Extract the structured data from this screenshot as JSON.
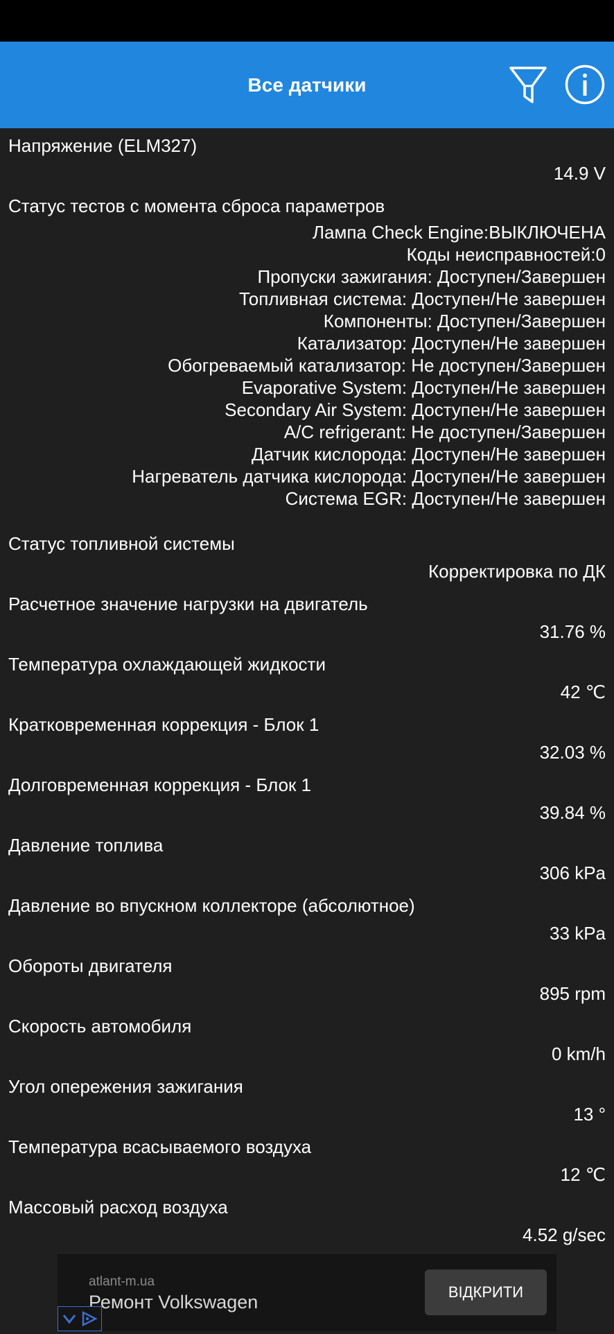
{
  "header": {
    "title": "Все датчики",
    "filter_icon": "filter-icon",
    "info_icon": "info-icon",
    "accent_color": "#2186de"
  },
  "sensors": [
    {
      "name": "Напряжение (ELM327)",
      "value": "14.9 V"
    },
    {
      "name": "Статус тестов с момента сброса параметров",
      "lines": [
        "Лампа Check Engine:ВЫКЛЮЧЕНА",
        "Коды неисправностей:0",
        "Пропуски зажигания: Доступен/Завершен",
        "Топливная система: Доступен/Не завершен",
        "Компоненты: Доступен/Завершен",
        "Катализатор: Доступен/Не завершен",
        "Обогреваемый катализатор: Не доступен/Завершен",
        "Evaporative System: Доступен/Не завершен",
        "Secondary Air System: Доступен/Не завершен",
        "A/C refrigerant: Не доступен/Завершен",
        "Датчик кислорода: Доступен/Не завершен",
        "Нагреватель датчика кислорода: Доступен/Не завершен",
        "Система EGR: Доступен/Не завершен"
      ]
    },
    {
      "name": "Статус топливной системы",
      "value": "Корректировка по ДК"
    },
    {
      "name": "Расчетное значение нагрузки на двигатель",
      "value": "31.76 %"
    },
    {
      "name": "Температура охлаждающей жидкости",
      "value": "42 ℃"
    },
    {
      "name": "Кратковременная коррекция - Блок 1",
      "value": "32.03 %"
    },
    {
      "name": "Долговременная коррекция - Блок 1",
      "value": "39.84 %"
    },
    {
      "name": "Давление топлива",
      "value": "306 kPa"
    },
    {
      "name": "Давление во впускном коллекторе (абсолютное)",
      "value": "33 kPa"
    },
    {
      "name": "Обороты двигателя",
      "value": "895 rpm"
    },
    {
      "name": "Скорость автомобиля",
      "value": "0 km/h"
    },
    {
      "name": "Угол опережения зажигания",
      "value": "13 °"
    },
    {
      "name": "Температура всасываемого воздуха",
      "value": "12 ℃"
    },
    {
      "name": "Массовый расход воздуха",
      "value": "4.52 g/sec"
    }
  ],
  "ad": {
    "domain": "atlant-m.ua",
    "title": "Ремонт Volkswagen",
    "button": "ВІДКРИТИ",
    "adchoices_icon": "adchoices-icon"
  }
}
